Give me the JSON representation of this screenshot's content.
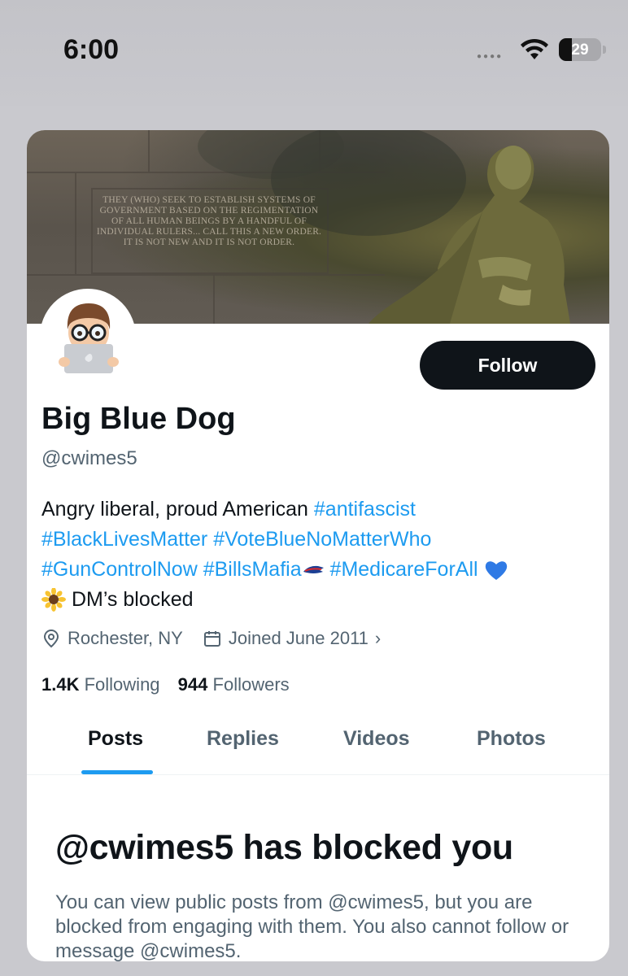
{
  "status_bar": {
    "time": "6:00",
    "battery": "29"
  },
  "banner": {
    "inscription": "THEY (WHO) SEEK TO ESTABLISH SYSTEMS OF GOVERNMENT BASED ON THE REGIMENTATION OF ALL HUMAN BEINGS BY A HANDFUL OF INDIVIDUAL RULERS... CALL THIS A NEW ORDER. IT IS NOT NEW AND IT IS NOT ORDER."
  },
  "profile": {
    "display_name": "Big Blue Dog",
    "handle": "@cwimes5",
    "follow_label": "Follow",
    "bio": {
      "line1_text": "Angry liberal, proud American ",
      "tag_antifascist": "#antifascist",
      "tag_blm": "#BlackLivesMatter",
      "tag_voteblue": "#VoteBlueNoMatterWho",
      "tag_guncontrol": "#GunControlNow",
      "tag_bills": "#BillsMafia",
      "tag_medicare": "#MedicareForAll",
      "dm_text": "DM’s blocked"
    },
    "location": "Rochester, NY",
    "joined": "Joined June 2011",
    "following_count": "1.4K",
    "following_label": "Following",
    "followers_count": "944",
    "followers_label": "Followers"
  },
  "tabs": [
    "Posts",
    "Replies",
    "Videos",
    "Photos"
  ],
  "blocked": {
    "title": "@cwimes5 has blocked you",
    "description": "You can view public posts from @cwimes5, but you are blocked from engaging with them. You also cannot follow or message @cwimes5."
  },
  "colors": {
    "accent": "#1d9bf0",
    "text": "#0f1419",
    "secondary": "#536471"
  },
  "icons": [
    "wifi-icon",
    "battery-icon",
    "location-pin-icon",
    "calendar-icon",
    "chevron-right-icon",
    "blue-heart-icon",
    "sunflower-icon",
    "bills-logo-icon"
  ]
}
